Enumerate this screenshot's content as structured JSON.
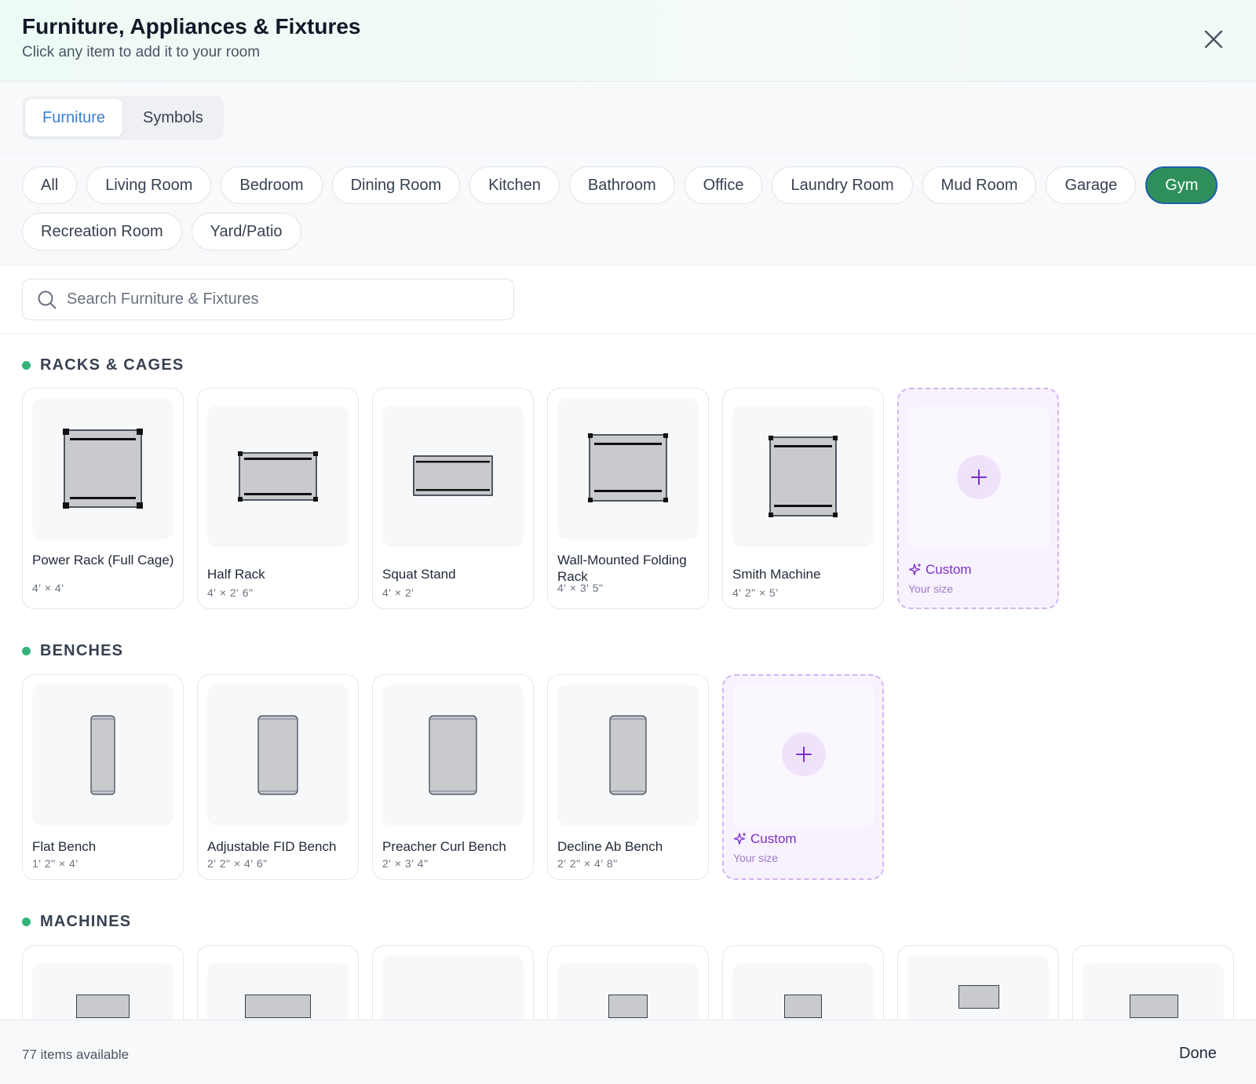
{
  "header": {
    "title": "Furniture, Appliances & Fixtures",
    "subtitle": "Click any item to add it to your room"
  },
  "tabs": [
    {
      "label": "Furniture",
      "active": true
    },
    {
      "label": "Symbols",
      "active": false
    }
  ],
  "categories": [
    {
      "label": "All"
    },
    {
      "label": "Living Room"
    },
    {
      "label": "Bedroom"
    },
    {
      "label": "Dining Room"
    },
    {
      "label": "Kitchen"
    },
    {
      "label": "Bathroom"
    },
    {
      "label": "Office"
    },
    {
      "label": "Laundry Room"
    },
    {
      "label": "Mud Room"
    },
    {
      "label": "Garage"
    },
    {
      "label": "Gym",
      "active": true
    },
    {
      "label": "Recreation Room"
    },
    {
      "label": "Yard/Patio"
    }
  ],
  "search": {
    "placeholder": "Search Furniture & Fixtures",
    "value": ""
  },
  "sections": [
    {
      "label": "RACKS & CAGES",
      "items": [
        {
          "name": "Power Rack (Full Cage)",
          "dims": "4' × 4'"
        },
        {
          "name": "Half Rack",
          "dims": "4' × 2' 6\""
        },
        {
          "name": "Squat Stand",
          "dims": "4' × 2'"
        },
        {
          "name": "Wall-Mounted Folding Rack",
          "dims": "4' × 3' 5\""
        },
        {
          "name": "Smith Machine",
          "dims": "4' 2\" × 5'"
        }
      ],
      "custom": {
        "title": "Custom",
        "subtitle": "Your size"
      }
    },
    {
      "label": "BENCHES",
      "items": [
        {
          "name": "Flat Bench",
          "dims": "1' 2\" × 4'"
        },
        {
          "name": "Adjustable FID Bench",
          "dims": "2' 2\" × 4' 6\""
        },
        {
          "name": "Preacher Curl Bench",
          "dims": "2' × 3' 4\""
        },
        {
          "name": "Decline Ab Bench",
          "dims": "2' 2\" × 4' 8\""
        }
      ],
      "custom": {
        "title": "Custom",
        "subtitle": "Your size"
      }
    },
    {
      "label": "MACHINES",
      "items": []
    }
  ],
  "footer": {
    "count_text": "77 items available",
    "done_label": "Done"
  },
  "colors": {
    "accent_green": "#2f8f5b",
    "tab_blue": "#3b7fd4",
    "custom_purple": "#7e2fc6"
  }
}
